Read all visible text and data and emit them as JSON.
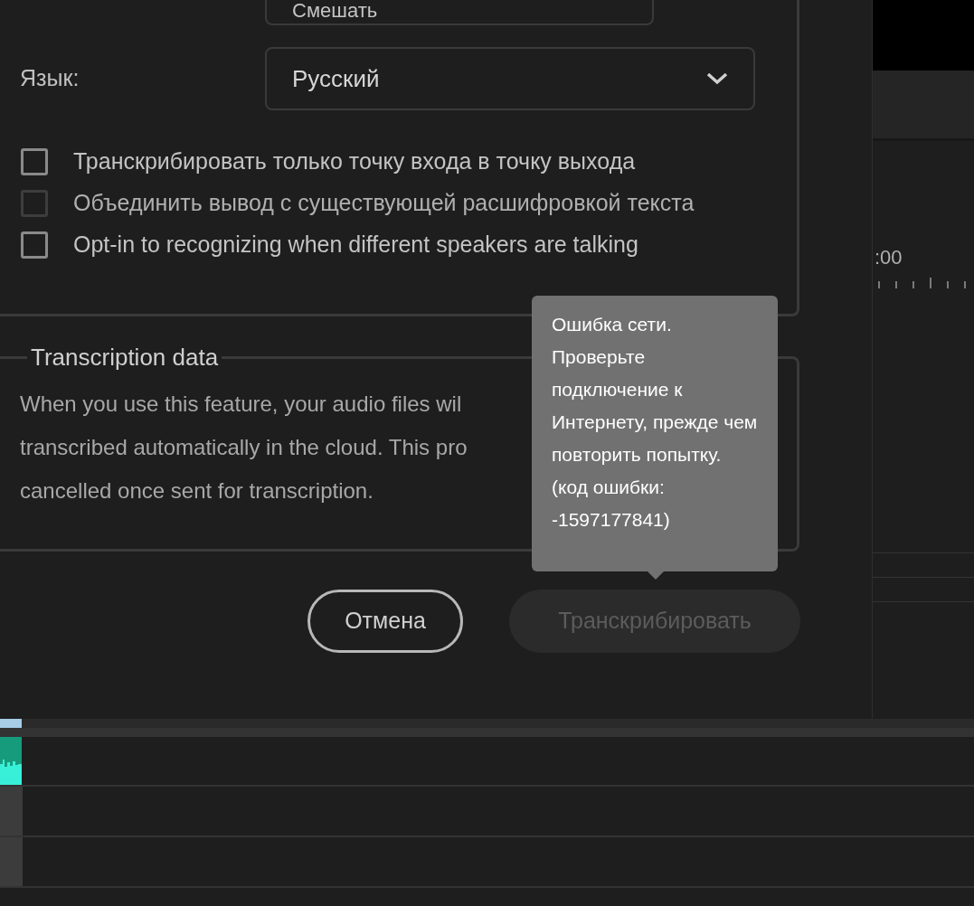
{
  "mix_field": {
    "value": "Смешать"
  },
  "language": {
    "label": "Язык:",
    "value": "Русский"
  },
  "options": [
    {
      "label": "Транскрибировать только точку входа в точку выхода",
      "checked": false,
      "disabled": false
    },
    {
      "label": "Объединить вывод с существующей расшифровкой текста",
      "checked": false,
      "disabled": true
    },
    {
      "label": "Opt-in to recognizing when different speakers are talking",
      "checked": false,
      "disabled": false
    }
  ],
  "transcription_data": {
    "title": "Transcription data",
    "lines": [
      "When you use this feature, your audio files wil",
      "transcribed automatically in the cloud. This pro",
      "cancelled once sent for transcription."
    ]
  },
  "buttons": [
    {
      "label": "Отмена",
      "disabled": false
    },
    {
      "label": "Транскрибировать",
      "disabled": true
    }
  ],
  "tooltip": {
    "text": "Ошибка сети. Проверьте подключение к Интернету, прежде чем повторить попытку. (код ошибки: -1597177841)"
  },
  "timeline": {
    "timecode": ":00"
  }
}
